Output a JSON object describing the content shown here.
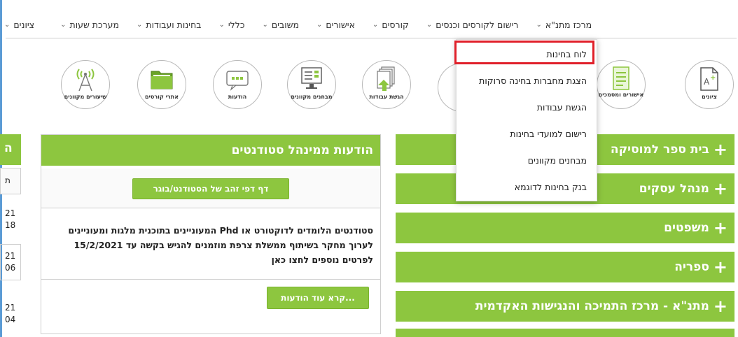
{
  "nav": {
    "items": [
      {
        "label": "ציונים"
      },
      {
        "label": "מערכת שעות"
      },
      {
        "label": "בחינות ועבודות"
      },
      {
        "label": "כללי"
      },
      {
        "label": "משובים"
      },
      {
        "label": "אישורים"
      },
      {
        "label": "קורסים"
      },
      {
        "label": "רישום לקורסים וכנסים"
      },
      {
        "label": "מרכז מתנ\"א"
      }
    ]
  },
  "icons": [
    {
      "label": "ציונים",
      "icon": "grades-doc-icon"
    },
    {
      "label": "אישורים ומסמכים",
      "icon": "document-list-icon"
    },
    {
      "label": "הגשת עבודות",
      "icon": "upload-docs-icon"
    },
    {
      "label": "מבחנים מקוונים",
      "icon": "online-exam-icon"
    },
    {
      "label": "הודעות",
      "icon": "chat-bubble-icon"
    },
    {
      "label": "אתרי קורסים",
      "icon": "folder-icon"
    },
    {
      "label": "שיעורים מקוונים",
      "icon": "broadcast-antenna-icon"
    }
  ],
  "dropdown": {
    "items": [
      {
        "label": "לוח בחינות"
      },
      {
        "label": "הצגת מחברות בחינה סרוקות"
      },
      {
        "label": "הגשת עבודות"
      },
      {
        "label": "רישום למועדי בחינות"
      },
      {
        "label": "מבחנים מקוונים"
      },
      {
        "label": "בנק בחינות לדוגמא"
      }
    ]
  },
  "accordion": [
    {
      "label": "בית ספר למוסיקה"
    },
    {
      "label": "מנהל עסקים"
    },
    {
      "label": "משפטים"
    },
    {
      "label": "ספריה"
    },
    {
      "label": "מתנ\"א - מרכז התמיכה והנגישות האקדמית"
    }
  ],
  "notices": {
    "title": "הודעות ממינהל סטודנטים",
    "gold_page_button": "דף דפי זהב של הסטודנט/בוגר",
    "body_line1": "סטודנטים הלומדים לדוקטורט או Phd המעוניינים בתוכנית מלגות ומעוניינים",
    "body_line2": "לערוך מחקר בשיתוף ממשלת צרפת מוזמנים להגיש בקשה עד 15/2/2021",
    "body_line3": "לפרטים נוספים לחצו כאן",
    "more_button": "קרא עוד הודעות..."
  },
  "left_panel": {
    "head": "ה",
    "row1": "ת",
    "date1a": "21",
    "date1b": "18",
    "date2a": "21",
    "date2b": "06",
    "date3a": "21",
    "date3b": "04"
  },
  "colors": {
    "accent": "#8dc63f",
    "highlight": "#e0202a",
    "frame": "#5b9bd5"
  }
}
